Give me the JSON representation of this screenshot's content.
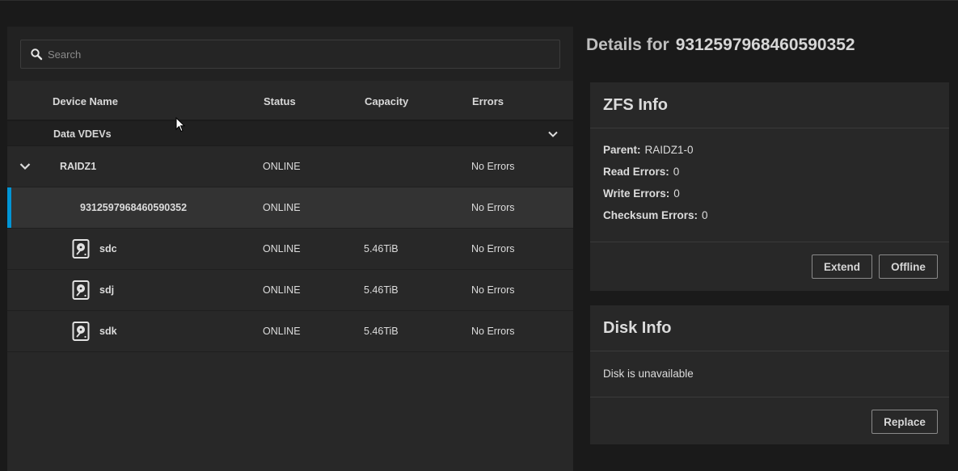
{
  "search": {
    "placeholder": "Search"
  },
  "table": {
    "headers": {
      "device_name": "Device Name",
      "status": "Status",
      "capacity": "Capacity",
      "errors": "Errors"
    },
    "group": {
      "label": "Data VDEVs"
    },
    "rows": [
      {
        "name": "RAIDZ1",
        "status": "ONLINE",
        "capacity": "",
        "errors": "No Errors"
      },
      {
        "name": "9312597968460590352",
        "status": "ONLINE",
        "capacity": "",
        "errors": "No Errors"
      },
      {
        "name": "sdc",
        "status": "ONLINE",
        "capacity": "5.46TiB",
        "errors": "No Errors"
      },
      {
        "name": "sdj",
        "status": "ONLINE",
        "capacity": "5.46TiB",
        "errors": "No Errors"
      },
      {
        "name": "sdk",
        "status": "ONLINE",
        "capacity": "5.46TiB",
        "errors": "No Errors"
      }
    ]
  },
  "details": {
    "prefix": "Details for",
    "id": "9312597968460590352"
  },
  "zfs_info": {
    "title": "ZFS Info",
    "fields": [
      {
        "label": "Parent:",
        "value": "RAIDZ1-0"
      },
      {
        "label": "Read Errors:",
        "value": "0"
      },
      {
        "label": "Write Errors:",
        "value": "0"
      },
      {
        "label": "Checksum Errors:",
        "value": "0"
      }
    ],
    "buttons": {
      "extend": "Extend",
      "offline": "Offline"
    }
  },
  "disk_info": {
    "title": "Disk Info",
    "message": "Disk is unavailable",
    "buttons": {
      "replace": "Replace"
    }
  },
  "colors": {
    "accent": "#0095d5",
    "background": "#1a1a1a",
    "panel": "#282828"
  },
  "icons": {
    "search": "search-icon",
    "chevron": "chevron-down-icon",
    "disk": "hard-disk-icon"
  }
}
